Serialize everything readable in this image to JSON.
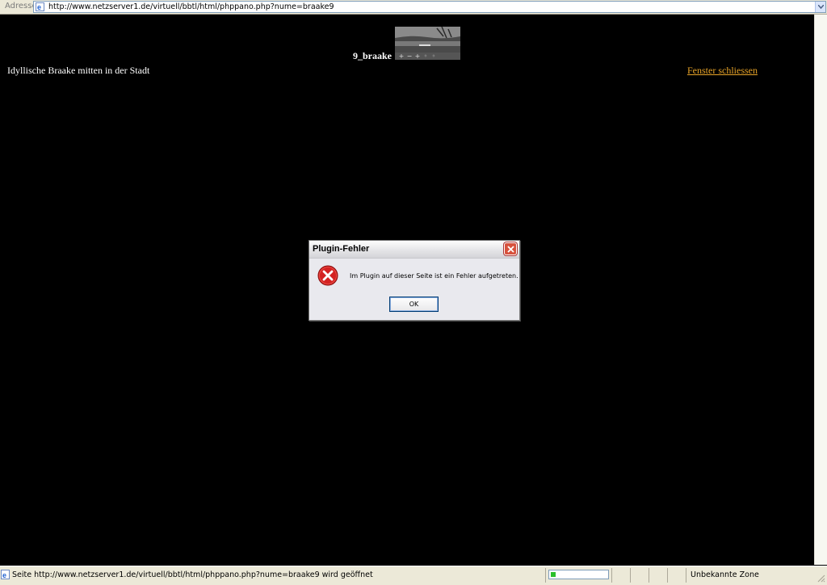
{
  "addressbar": {
    "label": "Adresse",
    "url": "http://www.netzserver1.de/virtuell/bbtl/html/phppano.php?nume=braake9"
  },
  "page": {
    "pano_title": "9_braake",
    "caption": "Idyllische Braake mitten in der Stadt",
    "close_link": "Fenster schliessen",
    "pano_controls": [
      "+",
      "−",
      "+",
      "◦",
      "◦"
    ]
  },
  "dialog": {
    "title": "Plugin-Fehler",
    "message": "Im Plugin auf dieser Seite ist ein Fehler aufgetreten.",
    "ok_label": "OK",
    "icon": "error-icon"
  },
  "statusbar": {
    "text": "Seite http://www.netzserver1.de/virtuell/bbtl/html/phppano.php?nume=braake9 wird geöffnet",
    "progress": 0.08,
    "zone": "Unbekannte Zone"
  },
  "colors": {
    "link": "#e8a428",
    "background": "#000000",
    "progress": "#2bc02b"
  }
}
